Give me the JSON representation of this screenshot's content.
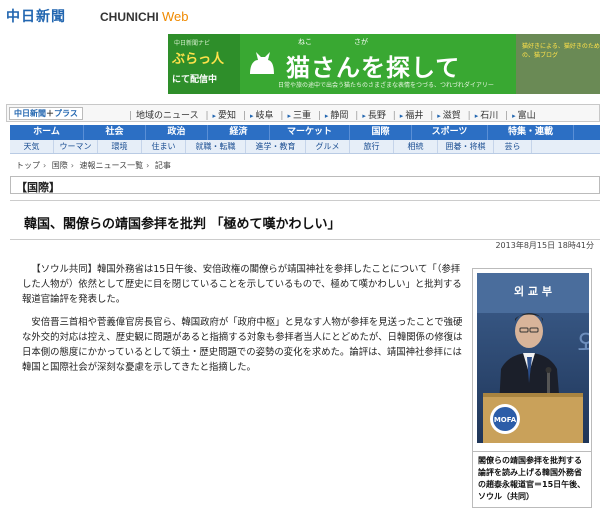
{
  "header": {
    "logo_jp": "中日新聞",
    "logo_en": "CHUNICHI",
    "logo_web": "Web"
  },
  "banner": {
    "small_label": "中日新聞ナビ",
    "brand": "ぶらっ人",
    "deliver": "にて配信中",
    "title": "猫さんを探して",
    "ruby": "ねこ　　　　　　さが",
    "sub": "日常や旅の途中で出会う猫たちのさまざまな表情をつづる、つれづれダイアリー",
    "right_text": "猫好きによる、猫好きのための、猫ブログ"
  },
  "plus_bar": {
    "logo": "中日新聞",
    "logo_plus": "プラス",
    "regions": [
      "地域のニュース",
      "愛知",
      "岐阜",
      "三重",
      "静岡",
      "長野",
      "福井",
      "滋賀",
      "石川",
      "富山"
    ]
  },
  "nav_main": [
    "ホーム",
    "社会",
    "政治",
    "経済",
    "マーケット",
    "国際",
    "スポーツ",
    "特集・連載"
  ],
  "nav_sub": [
    "天気",
    "ウーマン",
    "環境",
    "住まい",
    "就職・転職",
    "進学・教育",
    "グルメ",
    "旅行",
    "相続",
    "囲碁・将棋",
    "芸ら"
  ],
  "breadcrumb": [
    "トップ",
    "国際",
    "速報ニュース一覧",
    "記事"
  ],
  "section": "【国際】",
  "article": {
    "headline": "韓国、閣僚らの靖国参拝を批判 「極めて嘆かわしい」",
    "timestamp": "2013年8月15日 18時41分",
    "paragraphs": [
      "【ソウル共同】韓国外務省は15日午後、安倍政権の閣僚らが靖国神社を参拝したことについて「（参拝した人物が）依然として歴史に目を閉じていることを示しているもので、極めて嘆かわしい」と批判する報道官論評を発表した。",
      "安倍晋三首相や菅義偉官房長官ら、韓国政府が「政府中枢」と見なす人物が参拝を見送ったことで強硬な外交的対応は控え、歴史観に問題があると指摘する対象も参拝者当人にとどめたが、日韓関係の修復は日本側の態度にかかっているとして領土・歴史問題での姿勢の変化を求めた。論評は、靖国神社参拝には韓国と国際社会が深刻な憂慮を示してきたと指摘した。"
    ],
    "photo_sign": "외 교 부",
    "photo_logo": "MOFA",
    "caption": "閣僚らの靖国参拝を批判する論評を読み上げる韓国外務省の趙泰永報道官＝15日午後、ソウル（共同）"
  },
  "colors": {
    "nav_blue": "#2c6fc4",
    "banner_green": "#39a832",
    "logo_blue": "#2266b0",
    "web_orange": "#f08a00"
  }
}
